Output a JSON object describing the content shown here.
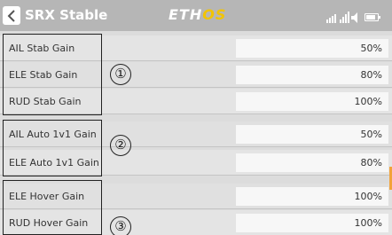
{
  "header": {
    "title": "SRX Stable",
    "logo_eth": "ETH",
    "logo_os": "OS"
  },
  "rows": [
    {
      "label": "AIL Stab Gain",
      "value": "50%"
    },
    {
      "label": "ELE Stab Gain",
      "value": "80%"
    },
    {
      "label": "RUD Stab Gain",
      "value": "100%"
    },
    {
      "label": "AIL Auto 1v1 Gain",
      "value": "50%"
    },
    {
      "label": "ELE Auto 1v1 Gain",
      "value": "80%"
    },
    {
      "label": "ELE Hover Gain",
      "value": "100%"
    },
    {
      "label": "RUD Hover Gain",
      "value": "100%"
    }
  ],
  "groups": [
    {
      "number": "①"
    },
    {
      "number": "②"
    },
    {
      "number": "③"
    }
  ],
  "colors": {
    "header_bg": "#b6b6b6",
    "logo_accent": "#f2c400",
    "scroll_accent": "#f2a33a"
  },
  "icons": [
    "back-arrow-icon",
    "signal-strength-icon",
    "speaker-icon",
    "battery-icon"
  ]
}
